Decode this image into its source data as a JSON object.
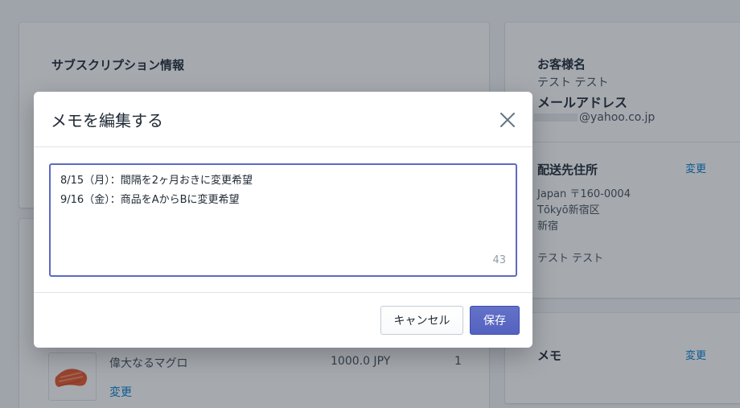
{
  "subscription": {
    "title": "サブスクリプション情報"
  },
  "product": {
    "name": "偉大なるマグロ",
    "price": "1000.0 JPY",
    "quantity": "1",
    "change_label": "変更"
  },
  "customer": {
    "name_label": "お客様名",
    "name": "テスト テスト",
    "email_label": "メールアドレス",
    "email": "@yahoo.co.jp",
    "shipping_label": "配送先住所",
    "shipping_change": "変更",
    "address_line1": "Japan 〒160-0004",
    "address_line2": "Tōkyō新宿区",
    "address_line3": "新宿",
    "recipient": "テスト テスト"
  },
  "memo_card": {
    "label": "メモ",
    "change": "変更"
  },
  "modal": {
    "title": "メモを編集する",
    "memo_lines": [
      "8/15（月）：間隔を2ヶ月おきに変更希望",
      "9/16（金）：商品をAからBに変更希望"
    ],
    "char_count": "43",
    "cancel_label": "キャンセル",
    "save_label": "保存"
  },
  "colors": {
    "accent": "#5c6ac4",
    "link": "#007ace",
    "overlay": "rgba(33,43,54,0.4)"
  }
}
